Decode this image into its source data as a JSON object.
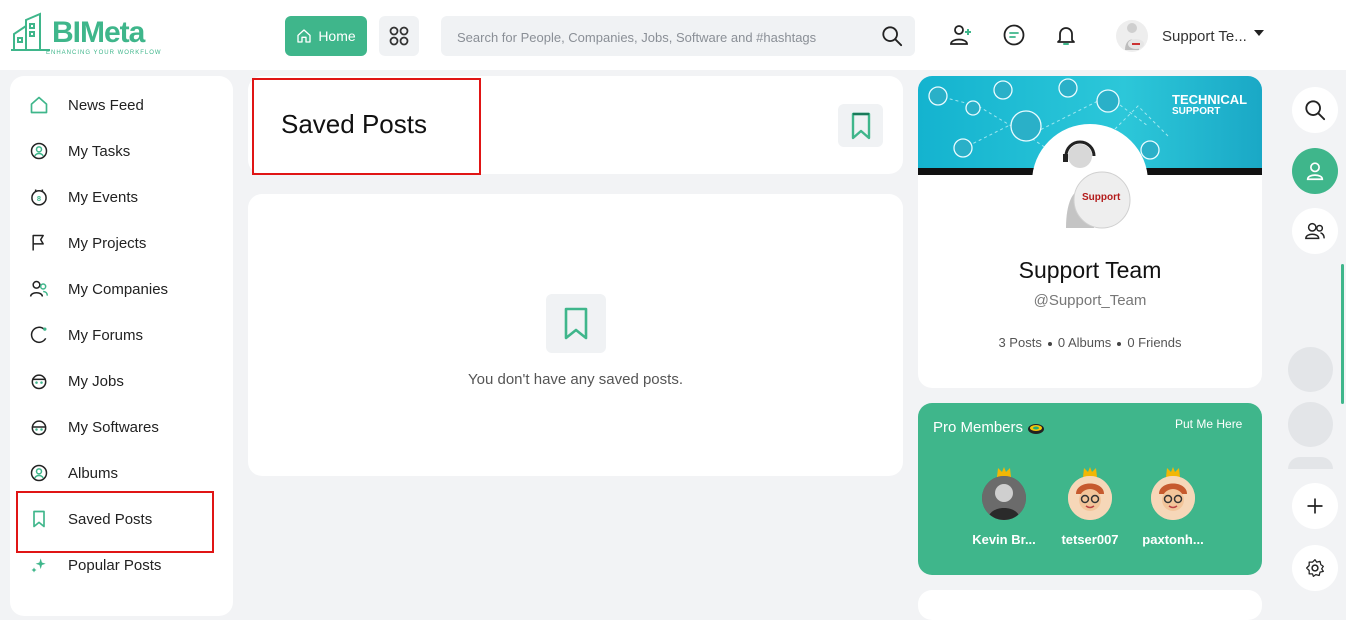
{
  "brand": {
    "name": "BIMeta",
    "tagline": "ENHANCING YOUR WORKFLOW",
    "accent": "#3fb68b"
  },
  "header": {
    "home_label": "Home",
    "search_placeholder": "Search for People, Companies, Jobs, Software and #hashtags",
    "user_name": "Support Te..."
  },
  "sidebar": {
    "items": [
      {
        "label": "News Feed",
        "icon": "home-icon"
      },
      {
        "label": "My Tasks",
        "icon": "tasks-icon"
      },
      {
        "label": "My Events",
        "icon": "calendar-icon"
      },
      {
        "label": "My Projects",
        "icon": "flag-icon"
      },
      {
        "label": "My Companies",
        "icon": "companies-icon"
      },
      {
        "label": "My Forums",
        "icon": "forum-icon"
      },
      {
        "label": "My Jobs",
        "icon": "jobs-icon"
      },
      {
        "label": "My Softwares",
        "icon": "software-icon"
      },
      {
        "label": "Albums",
        "icon": "album-icon"
      },
      {
        "label": "Saved Posts",
        "icon": "bookmark-icon"
      },
      {
        "label": "Popular Posts",
        "icon": "sparkle-icon"
      }
    ],
    "active": "Saved Posts"
  },
  "main": {
    "title": "Saved Posts",
    "empty_text": "You don't have any saved posts."
  },
  "profile": {
    "cover_title": "TECHNICAL",
    "cover_subtitle": "SUPPORT",
    "avatar_text": "Support",
    "name": "Support Team",
    "handle": "@Support_Team",
    "posts": "3 Posts",
    "albums": "0 Albums",
    "friends": "0 Friends"
  },
  "pro_members": {
    "title": "Pro Members",
    "link": "Put Me Here",
    "members": [
      {
        "name": "Kevin Br..."
      },
      {
        "name": "tetser007"
      },
      {
        "name": "paxtonh..."
      }
    ]
  }
}
